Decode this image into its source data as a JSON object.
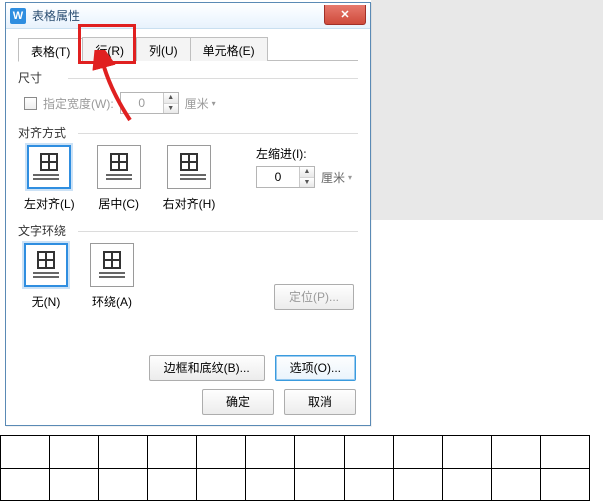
{
  "window": {
    "title": "表格属性",
    "app_icon_letter": "W",
    "close_glyph": "✕"
  },
  "tabs": {
    "table": "表格(T)",
    "row": "行(R)",
    "col": "列(U)",
    "cell": "单元格(E)"
  },
  "size": {
    "group_label": "尺寸",
    "chk_label": "指定宽度(W):",
    "width_value": "0",
    "unit": "厘米",
    "dd_glyph": "▾"
  },
  "align": {
    "group_label": "对齐方式",
    "left": "左对齐(L)",
    "center": "居中(C)",
    "right": "右对齐(H)",
    "indent_label": "左缩进(I):",
    "indent_value": "0",
    "indent_unit": "厘米",
    "dd_glyph": "▾"
  },
  "wrap": {
    "group_label": "文字环绕",
    "none": "无(N)",
    "around": "环绕(A)",
    "position_btn": "定位(P)..."
  },
  "bottom_buttons": {
    "border": "边框和底纹(B)...",
    "options": "选项(O)..."
  },
  "footer": {
    "ok": "确定",
    "cancel": "取消"
  },
  "spin_glyphs": {
    "up": "▲",
    "down": "▼"
  }
}
